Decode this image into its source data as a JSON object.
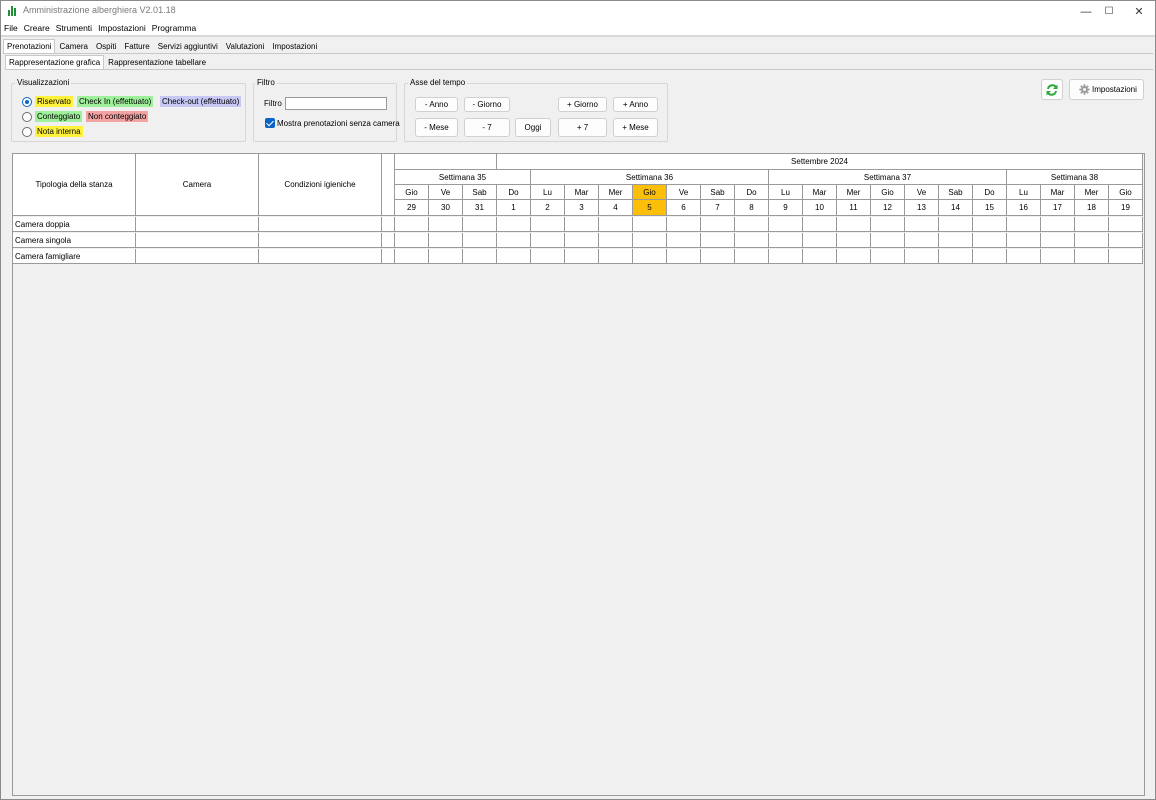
{
  "window": {
    "title": "Amministrazione alberghiera V2.01.18",
    "controls": [
      "—",
      "☐",
      "✕"
    ]
  },
  "menu": [
    "File",
    "Creare",
    "Strumenti",
    "Impostazioni",
    "Programma"
  ],
  "main_tabs": [
    "Prenotazioni",
    "Camera",
    "Ospiti",
    "Fatture",
    "Servizi aggiuntivi",
    "Valutazioni",
    "Impostazioni"
  ],
  "sub_tabs": [
    "Rappresentazione grafica",
    "Rappresentazione tabellare"
  ],
  "visualizzazioni": {
    "title": "Visualizzazioni",
    "riservato": "Riservato",
    "check_in": "Check In  (effettuato)",
    "check_out": "Check-out (effettuato)",
    "conteggiato": "Conteggiato",
    "non_conteggiato": "Non conteggiato",
    "nota_interna": "Nota interna",
    "colors": {
      "riservato": "#fff23a",
      "check_in": "#9ff09b",
      "check_out": "#c8c8f5",
      "conteggiato": "#9ff09b",
      "non_conteggiato": "#f4a3a3",
      "nota_interna": "#fff23a"
    }
  },
  "filtro": {
    "title": "Filtro",
    "label": "Filtro",
    "value": "",
    "checkbox_label": "Mostra prenotazioni senza camera",
    "checked": true
  },
  "asse": {
    "title": "Asse del tempo",
    "minus_anno": "- Anno",
    "minus_giorno": "- Giorno",
    "plus_giorno": "+ Giorno",
    "plus_anno": "+ Anno",
    "minus_mese": "- Mese",
    "minus_7": "- 7",
    "oggi": "Oggi",
    "plus_7": "+ 7",
    "plus_mese": "+ Mese"
  },
  "toolbar": {
    "refresh_icon": "refresh-icon",
    "settings_label": "Impostazioni",
    "settings_icon": "gear-icon"
  },
  "grid": {
    "header_cols": [
      "Tipologia della stanza",
      "Camera",
      "Condizioni igieniche"
    ],
    "month": "Settembre 2024",
    "weeks": [
      "Settimana 35",
      "Settimana 36",
      "Settimana 37",
      "Settimana 38"
    ],
    "days": [
      {
        "wd": "Gio",
        "d": "29"
      },
      {
        "wd": "Ve",
        "d": "30"
      },
      {
        "wd": "Sab",
        "d": "31"
      },
      {
        "wd": "Do",
        "d": "1"
      },
      {
        "wd": "Lu",
        "d": "2"
      },
      {
        "wd": "Mar",
        "d": "3"
      },
      {
        "wd": "Mer",
        "d": "4"
      },
      {
        "wd": "Gio",
        "d": "5"
      },
      {
        "wd": "Ve",
        "d": "6"
      },
      {
        "wd": "Sab",
        "d": "7"
      },
      {
        "wd": "Do",
        "d": "8"
      },
      {
        "wd": "Lu",
        "d": "9"
      },
      {
        "wd": "Mar",
        "d": "10"
      },
      {
        "wd": "Mer",
        "d": "11"
      },
      {
        "wd": "Gio",
        "d": "12"
      },
      {
        "wd": "Ve",
        "d": "13"
      },
      {
        "wd": "Sab",
        "d": "14"
      },
      {
        "wd": "Do",
        "d": "15"
      },
      {
        "wd": "Lu",
        "d": "16"
      },
      {
        "wd": "Mar",
        "d": "17"
      },
      {
        "wd": "Mer",
        "d": "18"
      },
      {
        "wd": "Gio",
        "d": "19"
      }
    ],
    "today": "5",
    "today_color": "#fbbf09",
    "rows": [
      "Camera doppia",
      "Camera singola",
      "Camera famigliare"
    ]
  }
}
